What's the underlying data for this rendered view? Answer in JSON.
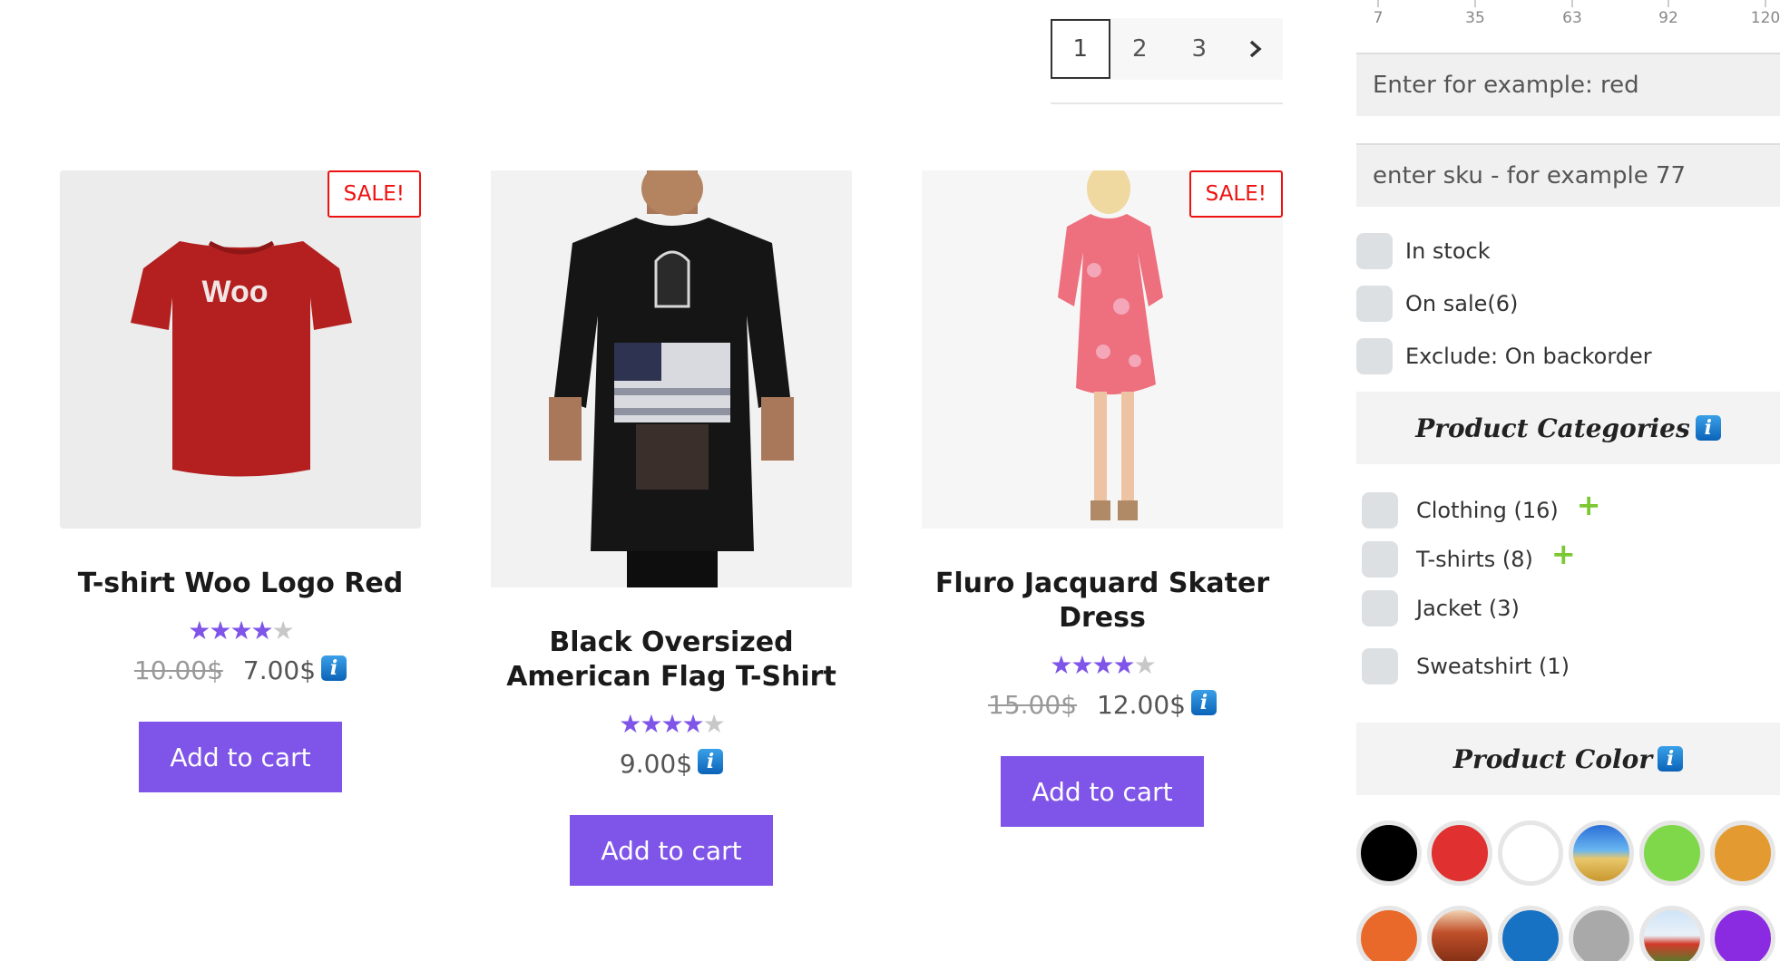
{
  "pagination": {
    "pages": [
      "1",
      "2",
      "3"
    ],
    "current": "1",
    "next_icon": "chevron-right-icon"
  },
  "products": [
    {
      "title": "T-shirt Woo Logo Red",
      "on_sale": true,
      "sale_label": "SALE!",
      "rating": 4,
      "rating_max": 5,
      "price_old": "10.00$",
      "price": "7.00$",
      "info_icon": "i",
      "button": "Add to cart",
      "image_print": "Woo"
    },
    {
      "title": "Black Oversized American Flag T-Shirt",
      "on_sale": false,
      "rating": 4,
      "rating_max": 5,
      "price": "9.00$",
      "info_icon": "i",
      "button": "Add to cart"
    },
    {
      "title": "Fluro Jacquard Skater Dress",
      "on_sale": true,
      "sale_label": "SALE!",
      "rating": 4,
      "rating_max": 5,
      "price_old": "15.00$",
      "price": "12.00$",
      "info_icon": "i",
      "button": "Add to cart"
    }
  ],
  "sidebar": {
    "price_scale": [
      "7",
      "35",
      "63",
      "92",
      "120"
    ],
    "color_input_placeholder": "Enter for example: red",
    "sku_input_placeholder": "enter sku - for example 77",
    "checkboxes": [
      "In stock",
      "On sale(6)",
      "Exclude: On backorder"
    ],
    "categories_title": "Product Categories",
    "categories": [
      {
        "label": "Clothing (16)",
        "expandable": true
      },
      {
        "label": "T-shirts (8)",
        "expandable": true
      },
      {
        "label": "Jacket (3)",
        "expandable": false
      },
      {
        "label": "Sweatshirt (1)",
        "expandable": false
      }
    ],
    "color_title": "Product Color",
    "info_icon": "i",
    "plus_icon": "+",
    "colors": [
      {
        "name": "black",
        "value": "#000000"
      },
      {
        "name": "red",
        "value": "#e03030"
      },
      {
        "name": "white",
        "value": "#ffffff"
      },
      {
        "name": "beach-image",
        "value": "image"
      },
      {
        "name": "green",
        "value": "#7fd84a"
      },
      {
        "name": "orange",
        "value": "#e39a30"
      },
      {
        "name": "dark-orange",
        "value": "#e8692a"
      },
      {
        "name": "autumn-image",
        "value": "image"
      },
      {
        "name": "blue",
        "value": "#1872c4"
      },
      {
        "name": "gray",
        "value": "#a9a9a9"
      },
      {
        "name": "tulips-image",
        "value": "image"
      },
      {
        "name": "purple",
        "value": "#8a2be2"
      }
    ]
  }
}
